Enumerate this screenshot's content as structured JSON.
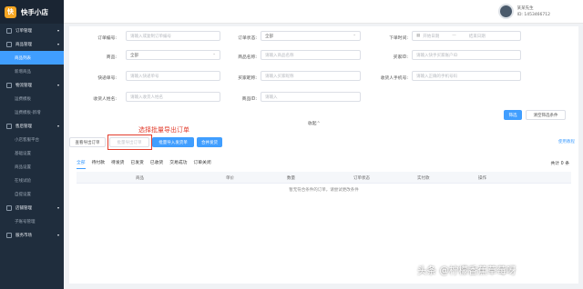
{
  "app": {
    "name": "快手小店",
    "logo_glyph": "快",
    "accent": "#409eff",
    "sidebar_bg": "#1f2d3d"
  },
  "sidebar": {
    "items": [
      {
        "label": "订单管理",
        "kind": "group"
      },
      {
        "label": "商品管理",
        "kind": "group"
      },
      {
        "label": "商品列表",
        "kind": "sub-active"
      },
      {
        "label": "新增商品",
        "kind": "sub"
      },
      {
        "label": "物流管理",
        "kind": "group"
      },
      {
        "label": "运费模板",
        "kind": "sub"
      },
      {
        "label": "运费模板-新增",
        "kind": "sub"
      },
      {
        "label": "售后管理",
        "kind": "group"
      },
      {
        "label": "小店客服平台",
        "kind": "sub"
      },
      {
        "label": "基础设置",
        "kind": "sub"
      },
      {
        "label": "商品设置",
        "kind": "sub"
      },
      {
        "label": "在线试验",
        "kind": "sub"
      },
      {
        "label": "自提设置",
        "kind": "sub"
      },
      {
        "label": "店铺管理",
        "kind": "group"
      },
      {
        "label": "子账号管理",
        "kind": "sub"
      },
      {
        "label": "服务市场",
        "kind": "group"
      }
    ]
  },
  "header": {
    "user_name": "某某先生",
    "user_id": "ID: 1453466712"
  },
  "filters": {
    "order_no": {
      "label": "订单编号:",
      "placeholder": "请输入或复制订单编号"
    },
    "order_status": {
      "label": "订单状态:",
      "value": "全部"
    },
    "order_time": {
      "label": "下单时间:",
      "start": "开始日期",
      "sep": "—",
      "end": "结束日期"
    },
    "product": {
      "label": "商品:",
      "value": "全部"
    },
    "product_name": {
      "label": "商品名称:",
      "placeholder": "请输入商品名称"
    },
    "buyer": {
      "label": "买家ID:",
      "placeholder": "请输入快手买家账户ID"
    },
    "tracking_no": {
      "label": "快递单号:",
      "placeholder": "请输入快递单号"
    },
    "buyer_nick": {
      "label": "买家昵称:",
      "placeholder": "请输入买家昵称"
    },
    "receiver_phone": {
      "label": "收货人手机号:",
      "placeholder": "请输入正确的手机号码"
    },
    "receiver_name": {
      "label": "收货人姓名:",
      "placeholder": "请输入收货人姓名"
    },
    "product_id": {
      "label": "商品ID:",
      "placeholder": "请输入"
    },
    "collapse_label": "收起",
    "search_label": "筛选",
    "clear_label": "清空筛选条件"
  },
  "actions": {
    "export_orders": "查看导出订单",
    "batch_export": "批量导出订单",
    "batch_import": "批量导入发货单",
    "merge_ship": "合并发货",
    "help": "使用教程"
  },
  "annotation": {
    "text": "选择批量导出订单",
    "color": "#e23c2c"
  },
  "tabs": {
    "items": [
      "全部",
      "待付款",
      "待发货",
      "已发货",
      "已收货",
      "交易成功",
      "订单关闭"
    ],
    "active_index": 0
  },
  "table": {
    "total": "共计 0 条",
    "columns": [
      "商品",
      "单价",
      "数量",
      "订单状态",
      "实付款",
      "操作"
    ],
    "empty_text": "暂无符合条件的订单，请尝试更改条件"
  },
  "watermark": "头条 @柠檬香蕉草莓呀"
}
